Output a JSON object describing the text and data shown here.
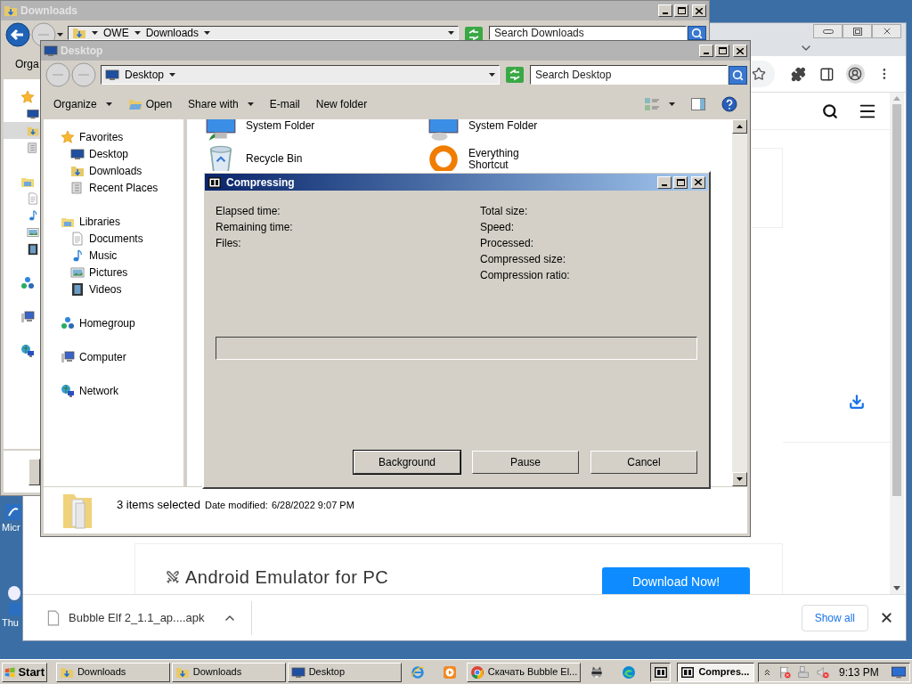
{
  "desktop": {
    "icon_labels": [
      "Micr",
      "Thu"
    ]
  },
  "browser": {
    "heading": "Android Emulator for PC",
    "cta": "Download Now!",
    "download": {
      "filename": "Bubble Elf 2_1.1_ap....apk",
      "show_all": "Show all"
    }
  },
  "downloads_window": {
    "title": "Downloads",
    "breadcrumb": [
      "OWE",
      "Downloads"
    ],
    "search": {
      "placeholder": "Search Downloads"
    },
    "toolbar_label": "Orga",
    "nav": [
      {
        "kind": "star",
        "selected": false,
        "children": [
          {
            "kind": "desktop",
            "selected": false
          },
          {
            "kind": "downloads",
            "selected": true
          },
          {
            "kind": "recent",
            "selected": false
          }
        ]
      },
      {
        "kind": "library",
        "selected": false,
        "children": [
          {
            "kind": "document",
            "selected": false
          },
          {
            "kind": "music",
            "selected": false
          },
          {
            "kind": "pictures",
            "selected": false
          },
          {
            "kind": "videos",
            "selected": false
          }
        ]
      },
      {
        "kind": "homegroup",
        "selected": false
      },
      {
        "kind": "computer",
        "selected": false
      },
      {
        "kind": "network",
        "selected": false
      }
    ]
  },
  "desktop_window": {
    "title": "Desktop",
    "address": "Desktop",
    "search": {
      "placeholder": "Search Desktop"
    },
    "toolbar": [
      {
        "label": "Organize",
        "kind": "menu"
      },
      {
        "label": "Open",
        "kind": "open"
      },
      {
        "label": "Share with",
        "kind": "menu"
      },
      {
        "label": "E-mail",
        "kind": "plain"
      },
      {
        "label": "New folder",
        "kind": "plain"
      }
    ],
    "nav": [
      {
        "label": "Favorites",
        "kind": "star",
        "children": [
          {
            "label": "Desktop",
            "kind": "desktop"
          },
          {
            "label": "Downloads",
            "kind": "downloads"
          },
          {
            "label": "Recent Places",
            "kind": "recent"
          }
        ]
      },
      {
        "label": "Libraries",
        "kind": "library",
        "children": [
          {
            "label": "Documents",
            "kind": "document"
          },
          {
            "label": "Music",
            "kind": "music"
          },
          {
            "label": "Pictures",
            "kind": "pictures"
          },
          {
            "label": "Videos",
            "kind": "videos"
          }
        ]
      },
      {
        "label": "Homegroup",
        "kind": "homegroup"
      },
      {
        "label": "Computer",
        "kind": "computer"
      },
      {
        "label": "Network",
        "kind": "network"
      }
    ],
    "files": [
      {
        "kind": "computer-folder",
        "lines": [
          "System Folder"
        ]
      },
      {
        "kind": "network-folder",
        "lines": [
          "System Folder"
        ]
      },
      {
        "kind": "recycle-bin",
        "lines": [
          "Recycle Bin"
        ]
      },
      {
        "kind": "everything",
        "lines": [
          "Everything",
          "Shortcut"
        ]
      }
    ],
    "details": {
      "summary": "3 items selected",
      "modified_label": "Date modified:",
      "modified": "6/28/2022 9:07 PM"
    }
  },
  "dialog": {
    "title": "Compressing",
    "left_labels": [
      "Elapsed time:",
      "Remaining time:",
      "Files:"
    ],
    "right_labels": [
      "Total size:",
      "Speed:",
      "Processed:",
      "Compressed size:",
      "Compression ratio:"
    ],
    "buttons": [
      "Background",
      "Pause",
      "Cancel"
    ]
  },
  "taskbar": {
    "start": "Start",
    "items": [
      {
        "kind": "downloads",
        "label": "Downloads",
        "selected": false
      },
      {
        "kind": "downloads",
        "label": "Downloads",
        "selected": false
      },
      {
        "kind": "desktop",
        "label": "Desktop",
        "selected": false
      },
      {
        "kind": "ie"
      },
      {
        "kind": "media"
      },
      {
        "kind": "chrome",
        "label": "Скачать Bubble El...",
        "selected": false
      },
      {
        "kind": "raccoon"
      },
      {
        "kind": "edge"
      },
      {
        "kind": "sevenz"
      },
      {
        "kind": "sevenz",
        "label": "Compres...",
        "selected": true
      }
    ],
    "time": "9:13 PM"
  }
}
